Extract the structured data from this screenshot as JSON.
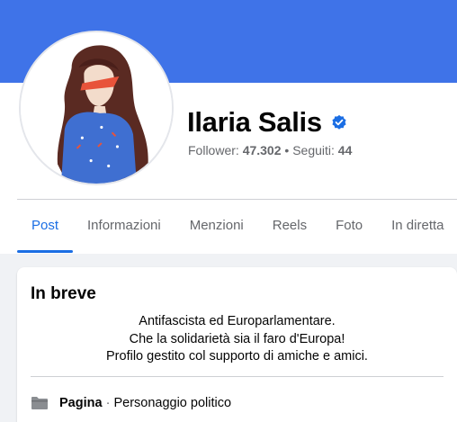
{
  "profile": {
    "name": "Ilaria Salis",
    "verified_icon": "verified-badge-icon",
    "followers_label": "Follower:",
    "followers_count": "47.302",
    "separator": "•",
    "following_label": "Seguiti:",
    "following_count": "44"
  },
  "tabs": [
    {
      "label": "Post",
      "active": true
    },
    {
      "label": "Informazioni",
      "active": false
    },
    {
      "label": "Menzioni",
      "active": false
    },
    {
      "label": "Reels",
      "active": false
    },
    {
      "label": "Foto",
      "active": false
    },
    {
      "label": "In diretta",
      "active": false
    }
  ],
  "intro": {
    "title": "In breve",
    "bio_lines": [
      "Antifascista ed Europarlamentare.",
      "Che la solidarietà sia il faro d'Europa!",
      "Profilo gestito col supporto di amiche e amici."
    ],
    "page_type_label": "Pagina",
    "page_type_separator": "·",
    "page_category": "Personaggio politico",
    "page_icon": "folder-icon"
  },
  "colors": {
    "cover": "#3f73e8",
    "accent": "#1b6ee4",
    "muted_text": "#65676b",
    "background": "#f0f2f5"
  }
}
